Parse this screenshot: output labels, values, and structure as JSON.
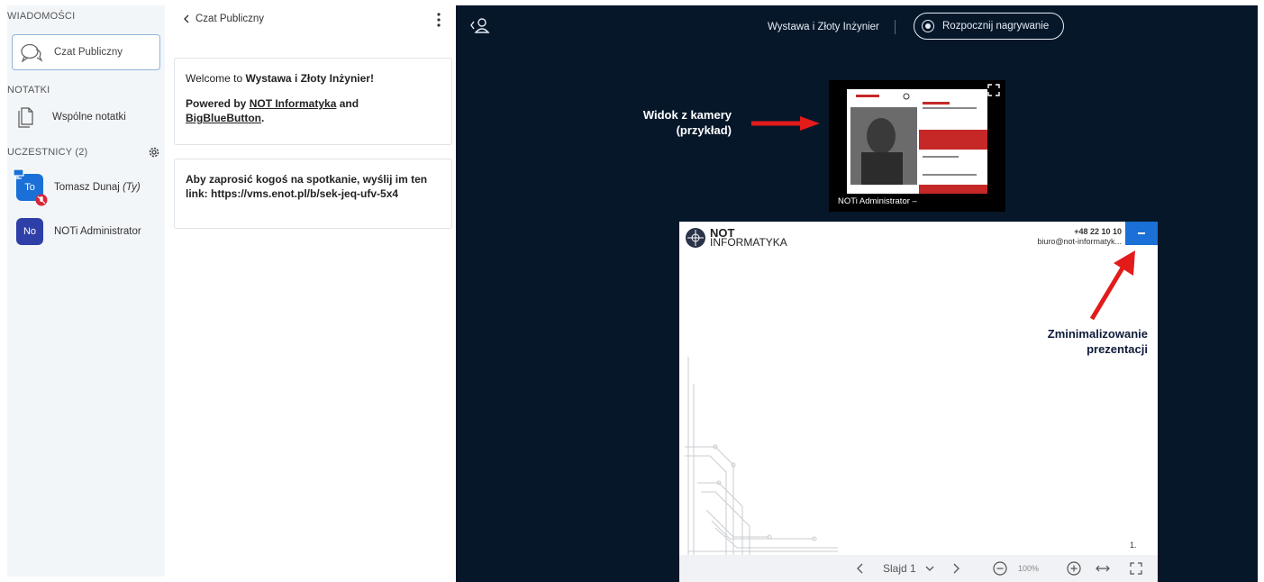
{
  "userlist": {
    "messages_title": "WIADOMOŚCI",
    "public_chat_label": "Czat Publiczny",
    "notes_title": "NOTATKI",
    "shared_notes_label": "Wspólne notatki",
    "participants_title": "UCZESTNICY (2)",
    "users": [
      {
        "initials": "To",
        "name": "Tomasz Dunaj",
        "suffix": "(Ty)",
        "color": "#1a70d6"
      },
      {
        "initials": "No",
        "name": "NOTi Administrator",
        "suffix": "",
        "color": "#2e3fa8"
      }
    ]
  },
  "chat": {
    "title": "Czat Publiczny",
    "welcome_1": "Welcome to ",
    "welcome_bold": "Wystawa i Złoty Inżynier",
    "welcome_end": "!",
    "powered_1": "Powered by ",
    "powered_link1": "NOT Informatyka",
    "powered_and": " and",
    "powered_link2": "BigBlueButton",
    "powered_end": ".",
    "invite": "Aby zaprosić kogoś na spotkanie, wyślij im ten link: https://vms.enot.pl/b/sek-jeq-ufv-5x4"
  },
  "main": {
    "meeting_title": "Wystawa i Złoty Inżynier",
    "record_label": "Rozpocznij nagrywanie",
    "webcam_name": "NOTi Administrator –",
    "camera_annotation_line1": "Widok z kamery",
    "camera_annotation_line2": "(przykład)",
    "minimize_annotation_line1": "Zminimalizowanie",
    "minimize_annotation_line2": "prezentacji"
  },
  "presentation": {
    "logo_line1": "NOT",
    "logo_line2": "INFORMATYKA",
    "phone": "+48 22 10 10",
    "email": "biuro@not-informatyk...",
    "slide_number": "1.",
    "toolbar": {
      "slide_label": "Slajd 1",
      "zoom": "100%"
    }
  },
  "colors": {
    "main_bg": "#06172a",
    "accent_blue": "#1a70d6",
    "annotation_arrow": "#e31b1b"
  }
}
